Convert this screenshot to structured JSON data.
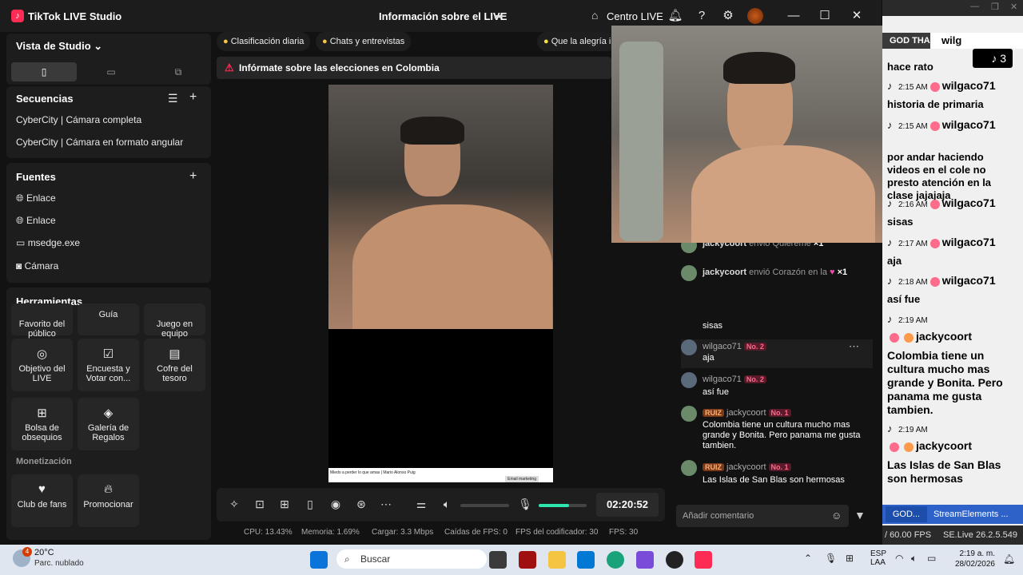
{
  "titlebar": {
    "app_name": "TikTok LIVE Studio",
    "center_title": "Información sobre el LIVE",
    "centro_live": "Centro LIVE"
  },
  "studio_view": {
    "title": "Vista de Studio"
  },
  "sequences": {
    "title": "Secuencias",
    "items": [
      "CyberCity | Cámara completa",
      "CyberCity | Cámara en formato angular"
    ]
  },
  "sources": {
    "title": "Fuentes",
    "items": [
      {
        "label": "Enlace",
        "icon": "globe-icon"
      },
      {
        "label": "Enlace",
        "icon": "globe-icon"
      },
      {
        "label": "msedge.exe",
        "icon": "window-icon"
      },
      {
        "label": "Cámara",
        "icon": "camera-icon"
      }
    ]
  },
  "tools": {
    "title": "Herramientas",
    "partial": [
      "Favorito del público",
      "Guía",
      "Juego en equipo"
    ],
    "items": [
      {
        "label": "Objetivo del LIVE",
        "icon": "target-icon"
      },
      {
        "label": "Encuesta y Votar con...",
        "icon": "poll-icon"
      },
      {
        "label": "Cofre del tesoro",
        "icon": "chest-icon"
      },
      {
        "label": "Bolsa de obsequios",
        "icon": "gift-bag-icon"
      },
      {
        "label": "Galería de Regalos",
        "icon": "gift-gallery-icon"
      }
    ],
    "monetization_title": "Monetización",
    "monetization": [
      {
        "label": "Club de fans",
        "icon": "heart-icon"
      },
      {
        "label": "Promocionar",
        "icon": "flame-icon"
      }
    ]
  },
  "top_pills": [
    "Clasificación diaria",
    "Chats y entrevistas",
    "Que la alegría i"
  ],
  "alert": "Infórmate sobre las elecciones en Colombia",
  "preview_strip": "Miedo a perder lo que amas | Mario Alonso Puig",
  "preview_button": "Email marketing",
  "timer": "02:20:52",
  "stats": {
    "cpu": "CPU: 13.43%",
    "memory": "Memoria: 1.69%",
    "upload": "Cargar: 3.3 Mbps",
    "fps_drops": "Caídas de FPS: 0",
    "encoder_fps": "FPS del codificador: 30",
    "fps": "FPS: 30"
  },
  "volume_level": 0.0,
  "mic_level": 0.63,
  "chat": {
    "gifts": [
      {
        "user": "jackycoort",
        "text": "envió Quiéreme",
        "count": "×1"
      },
      {
        "user": "jackycoort",
        "text": "envió Corazón en la",
        "count": "×1"
      }
    ],
    "messages": [
      {
        "name": "",
        "badge": "",
        "text": "sisas"
      },
      {
        "name": "wilgaco71",
        "badge": "No. 2",
        "text": "aja"
      },
      {
        "name": "wilgaco71",
        "badge": "No. 2",
        "text": "así fue"
      },
      {
        "name": "jackycoort",
        "ruiz": "RUIZ",
        "badge": "No. 1",
        "text": "Colombia tiene un cultura mucho mas grande y Bonita. Pero panama me gusta tambien."
      },
      {
        "name": "jackycoort",
        "ruiz": "RUIZ",
        "badge": "No. 1",
        "text": "Las Islas de San Blas son hermosas"
      }
    ],
    "comment_placeholder": "Añadir comentario"
  },
  "overlay": {
    "header": "GOD THANKS",
    "viewer_count": "3",
    "top_partial": [
      "wilg",
      "hace rato"
    ],
    "messages": [
      {
        "time": "2:15 AM",
        "user": "wilgaco71",
        "text": "historia de primaria"
      },
      {
        "time": "2:15 AM",
        "user": "wilgaco71",
        "text": "por andar haciendo videos en el cole no presto atención en la clase jajajaja"
      },
      {
        "time": "2:16 AM",
        "user": "wilgaco71",
        "text": "sisas"
      },
      {
        "time": "2:17 AM",
        "user": "wilgaco71",
        "text": "aja"
      },
      {
        "time": "2:18 AM",
        "user": "wilgaco71",
        "text": "así fue"
      },
      {
        "time": "2:19 AM",
        "user": "jackycoort",
        "text": "Colombia tiene un cultura mucho mas grande y Bonita. Pero panama me gusta tambien."
      },
      {
        "time": "2:19 AM",
        "user": "jackycoort",
        "text": "Las Islas de San Blas son hermosas"
      }
    ],
    "bottom_tabs": [
      "GOD...",
      "StreamElements ..."
    ],
    "fps": "/ 60.00 FPS",
    "version": "SE.Live 26.2.5.549"
  },
  "taskbar": {
    "weather_temp": "20°C",
    "weather_desc": "Parc. nublado",
    "weather_badge": "4",
    "search_placeholder": "Buscar",
    "lang_line1": "ESP",
    "lang_line2": "LAA",
    "time": "2:19 a. m.",
    "date": "28/02/2026"
  }
}
